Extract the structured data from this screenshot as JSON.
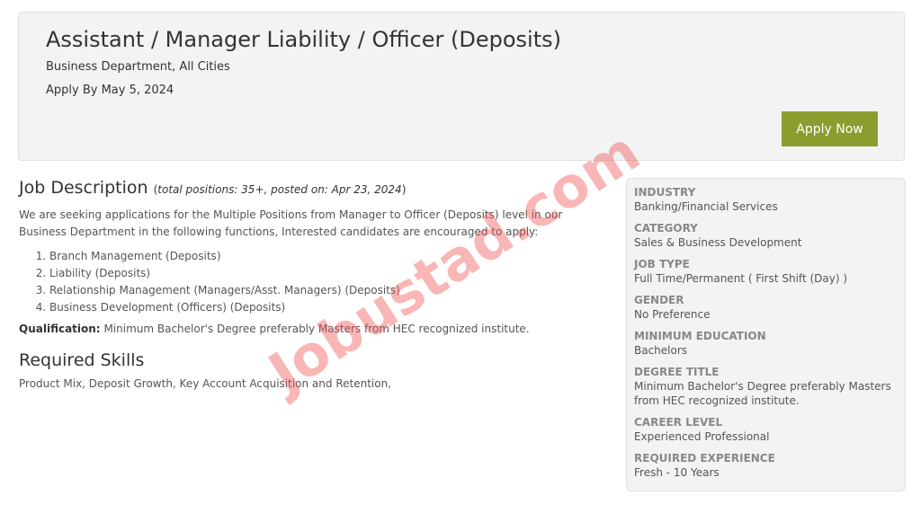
{
  "header": {
    "title": "Assistant / Manager Liability / Officer (Deposits)",
    "department": "Business Department, All Cities",
    "apply_by": "Apply By May 5, 2024",
    "apply_button": "Apply Now"
  },
  "job_description": {
    "heading": "Job Description",
    "meta_open": "(",
    "meta": "total positions: 35+, posted on: Apr 23, 2024",
    "meta_close": ")",
    "intro": "We are seeking applications for the Multiple Positions from Manager to Officer (Deposits) level in our Business Department in the following functions, Interested candidates are encouraged to apply:",
    "functions": [
      "Branch Management (Deposits)",
      "Liability (Deposits)",
      "Relationship Management (Managers/Asst. Managers) (Deposits)",
      "Business Development (Officers) (Deposits)"
    ],
    "qualification_label": "Qualification:",
    "qualification": "Minimum Bachelor's Degree preferably Masters from HEC recognized institute."
  },
  "skills": {
    "heading": "Required Skills",
    "text": "Product Mix, Deposit Growth, Key Account Acquisition and Retention,"
  },
  "sidebar": {
    "items": [
      {
        "label": "INDUSTRY",
        "value": "Banking/Financial Services"
      },
      {
        "label": "CATEGORY",
        "value": "Sales & Business Development"
      },
      {
        "label": "JOB TYPE",
        "value": "Full Time/Permanent ( First Shift (Day) )"
      },
      {
        "label": "GENDER",
        "value": "No Preference"
      },
      {
        "label": "MINIMUM EDUCATION",
        "value": "Bachelors"
      },
      {
        "label": "DEGREE TITLE",
        "value": "Minimum Bachelor's Degree preferably Masters from HEC recognized institute."
      },
      {
        "label": "CAREER LEVEL",
        "value": "Experienced Professional"
      },
      {
        "label": "REQUIRED EXPERIENCE",
        "value": "Fresh - 10 Years"
      }
    ]
  },
  "watermark": "Jobustad.com",
  "colors": {
    "accent": "#8d9c2f",
    "panel": "#f3f3f3",
    "watermark": "#f05050"
  }
}
